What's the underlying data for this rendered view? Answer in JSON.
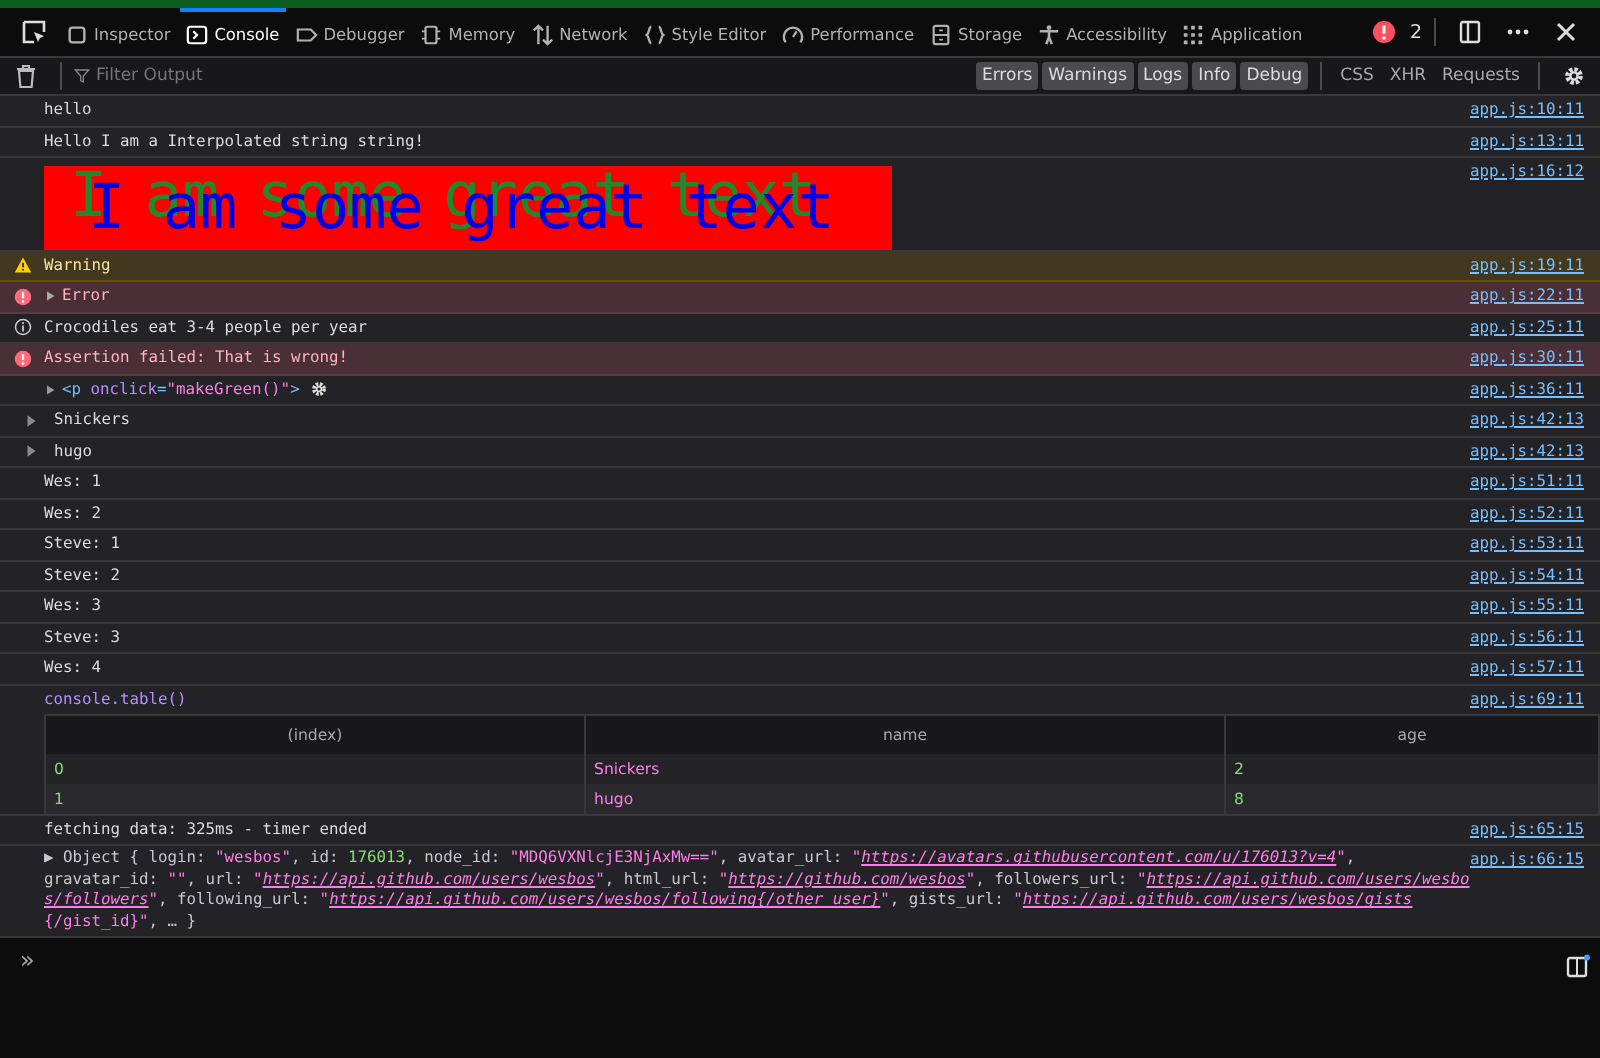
{
  "tabs": [
    {
      "label": "Inspector",
      "selected": false
    },
    {
      "label": "Console",
      "selected": true
    },
    {
      "label": "Debugger",
      "selected": false
    },
    {
      "label": "Memory",
      "selected": false
    },
    {
      "label": "Network",
      "selected": false
    },
    {
      "label": "Style Editor",
      "selected": false
    },
    {
      "label": "Performance",
      "selected": false
    },
    {
      "label": "Storage",
      "selected": false
    },
    {
      "label": "Accessibility",
      "selected": false
    },
    {
      "label": "Application",
      "selected": false
    }
  ],
  "error_count": "2",
  "filter": {
    "placeholder": "Filter Output"
  },
  "levels": [
    {
      "label": "Errors",
      "selected": true
    },
    {
      "label": "Warnings",
      "selected": true
    },
    {
      "label": "Logs",
      "selected": true
    },
    {
      "label": "Info",
      "selected": true
    },
    {
      "label": "Debug",
      "selected": true
    }
  ],
  "types": [
    {
      "label": "CSS",
      "selected": false
    },
    {
      "label": "XHR",
      "selected": false
    },
    {
      "label": "Requests",
      "selected": false
    }
  ],
  "messages": [
    {
      "kind": "log",
      "text": "hello",
      "source": "app.js:10:11"
    },
    {
      "kind": "log",
      "text": "Hello I am a Interpolated string string!",
      "source": "app.js:13:11"
    },
    {
      "kind": "styled",
      "text": "I am some great text",
      "source": "app.js:16:12"
    },
    {
      "kind": "warning",
      "text": "Warning",
      "source": "app.js:19:11"
    },
    {
      "kind": "error",
      "expandable": true,
      "text": "Error",
      "source": "app.js:22:11"
    },
    {
      "kind": "info",
      "text": "Crocodiles eat 3-4 people per year",
      "source": "app.js:25:11"
    },
    {
      "kind": "error",
      "expandable": false,
      "text": "Assertion failed: That is wrong!",
      "source": "app.js:30:11"
    },
    {
      "kind": "element",
      "parts": [
        {
          "kind": "tag",
          "text": "<p "
        },
        {
          "kind": "attr",
          "text": "onclick"
        },
        {
          "kind": "tag",
          "text": "="
        },
        {
          "kind": "value",
          "text": "\"makeGreen()\""
        },
        {
          "kind": "tag",
          "text": ">"
        }
      ],
      "source": "app.js:36:11"
    },
    {
      "kind": "object",
      "text": "Snickers",
      "source": "app.js:42:13"
    },
    {
      "kind": "object",
      "text": "hugo",
      "source": "app.js:42:13"
    },
    {
      "kind": "log",
      "text": "Wes: 1",
      "source": "app.js:51:11"
    },
    {
      "kind": "log",
      "text": "Wes: 2",
      "source": "app.js:52:11"
    },
    {
      "kind": "log",
      "text": "Steve: 1",
      "source": "app.js:53:11"
    },
    {
      "kind": "log",
      "text": "Steve: 2",
      "source": "app.js:54:11"
    },
    {
      "kind": "log",
      "text": "Wes: 3",
      "source": "app.js:55:11"
    },
    {
      "kind": "log",
      "text": "Steve: 3",
      "source": "app.js:56:11"
    },
    {
      "kind": "log",
      "text": "Wes: 4",
      "source": "app.js:57:11"
    },
    {
      "kind": "table",
      "text": "console.table()",
      "source": "app.js:69:11",
      "table": {
        "columns": [
          "(index)",
          "name",
          "age"
        ],
        "rows": [
          [
            "0",
            "Snickers",
            "2"
          ],
          [
            "1",
            "hugo",
            "8"
          ]
        ]
      }
    },
    {
      "kind": "log",
      "text": "fetching data: 325ms - timer ended",
      "source": "app.js:65:15"
    },
    {
      "kind": "preview",
      "source": "app.js:66:15",
      "lines": [
        [
          {
            "kind": "text",
            "text": "▶ Object { login: "
          },
          {
            "kind": "string",
            "text": "\"wesbos\""
          },
          {
            "kind": "text",
            "text": ", id: "
          },
          {
            "kind": "number",
            "text": "176013"
          },
          {
            "kind": "text",
            "text": ", node_id: "
          },
          {
            "kind": "string",
            "text": "\"MDQ6VXNlcjE3NjAxMw==\""
          },
          {
            "kind": "text",
            "text": ", avatar_url: "
          },
          {
            "kind": "string",
            "text": "\""
          },
          {
            "kind": "link",
            "text": "https://avatars.githubusercontent.com/u/176013?v=4"
          },
          {
            "kind": "string",
            "text": "\""
          },
          {
            "kind": "text",
            "text": ","
          }
        ],
        [
          {
            "kind": "text",
            "text": "gravatar_id: "
          },
          {
            "kind": "string",
            "text": "\"\""
          },
          {
            "kind": "text",
            "text": ", url: "
          },
          {
            "kind": "string",
            "text": "\""
          },
          {
            "kind": "link",
            "text": "https://api.github.com/users/wesbos"
          },
          {
            "kind": "string",
            "text": "\""
          },
          {
            "kind": "text",
            "text": ", html_url: "
          },
          {
            "kind": "string",
            "text": "\""
          },
          {
            "kind": "link",
            "text": "https://github.com/wesbos"
          },
          {
            "kind": "string",
            "text": "\""
          },
          {
            "kind": "text",
            "text": ", followers_url: "
          },
          {
            "kind": "string",
            "text": "\""
          },
          {
            "kind": "link",
            "text": "https://api.github.com/users/wesbo"
          }
        ],
        [
          {
            "kind": "link",
            "text": "s/followers"
          },
          {
            "kind": "string",
            "text": "\""
          },
          {
            "kind": "text",
            "text": ", following_url: "
          },
          {
            "kind": "string",
            "text": "\""
          },
          {
            "kind": "link",
            "text": "https://api.github.com/users/wesbos/following{/other_user}"
          },
          {
            "kind": "string",
            "text": "\""
          },
          {
            "kind": "text",
            "text": ", gists_url: "
          },
          {
            "kind": "string",
            "text": "\""
          },
          {
            "kind": "link",
            "text": "https://api.github.com/users/wesbos/gists"
          }
        ],
        [
          {
            "kind": "string",
            "text": "{/gist_id}\""
          },
          {
            "kind": "text",
            "text": ", … }"
          }
        ]
      ]
    }
  ],
  "prompt": "»"
}
